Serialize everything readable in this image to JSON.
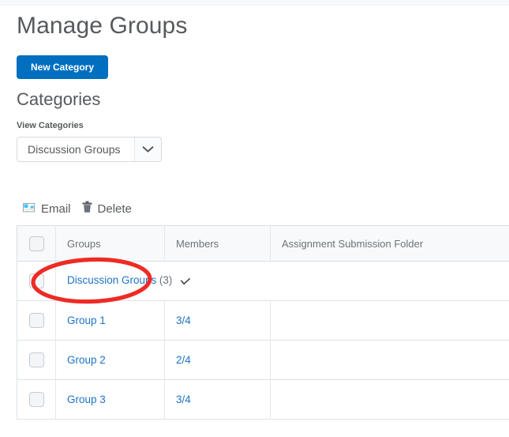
{
  "page": {
    "title": "Manage Groups"
  },
  "actions": {
    "new_category_label": "New Category"
  },
  "categories_section": {
    "heading": "Categories",
    "view_categories_label": "View Categories",
    "selected_category": "Discussion Groups",
    "options": [
      "Discussion Groups"
    ]
  },
  "toolbar": {
    "email_label": "Email",
    "delete_label": "Delete",
    "email_icon": "email-icon",
    "delete_icon": "trash-icon"
  },
  "table": {
    "columns": [
      "",
      "Groups",
      "Members",
      "Assignment Submission Folder"
    ],
    "category_row": {
      "name": "Discussion Groups",
      "count": "(3)",
      "members": "",
      "folder": ""
    },
    "rows": [
      {
        "group": "Group 1",
        "members": "3/4",
        "folder": ""
      },
      {
        "group": "Group 2",
        "members": "2/4",
        "folder": ""
      },
      {
        "group": "Group 3",
        "members": "3/4",
        "folder": ""
      }
    ]
  },
  "annotation": {
    "shape": "ellipse",
    "color": "#ee2b24",
    "targets": "Discussion Groups (3)"
  },
  "colors": {
    "primary_button": "#006fbf",
    "link": "#1d74c6",
    "text": "#565a5c",
    "header_bg": "#f7f9fa",
    "border": "#dde3ea",
    "annotation_red": "#ee2b24"
  }
}
